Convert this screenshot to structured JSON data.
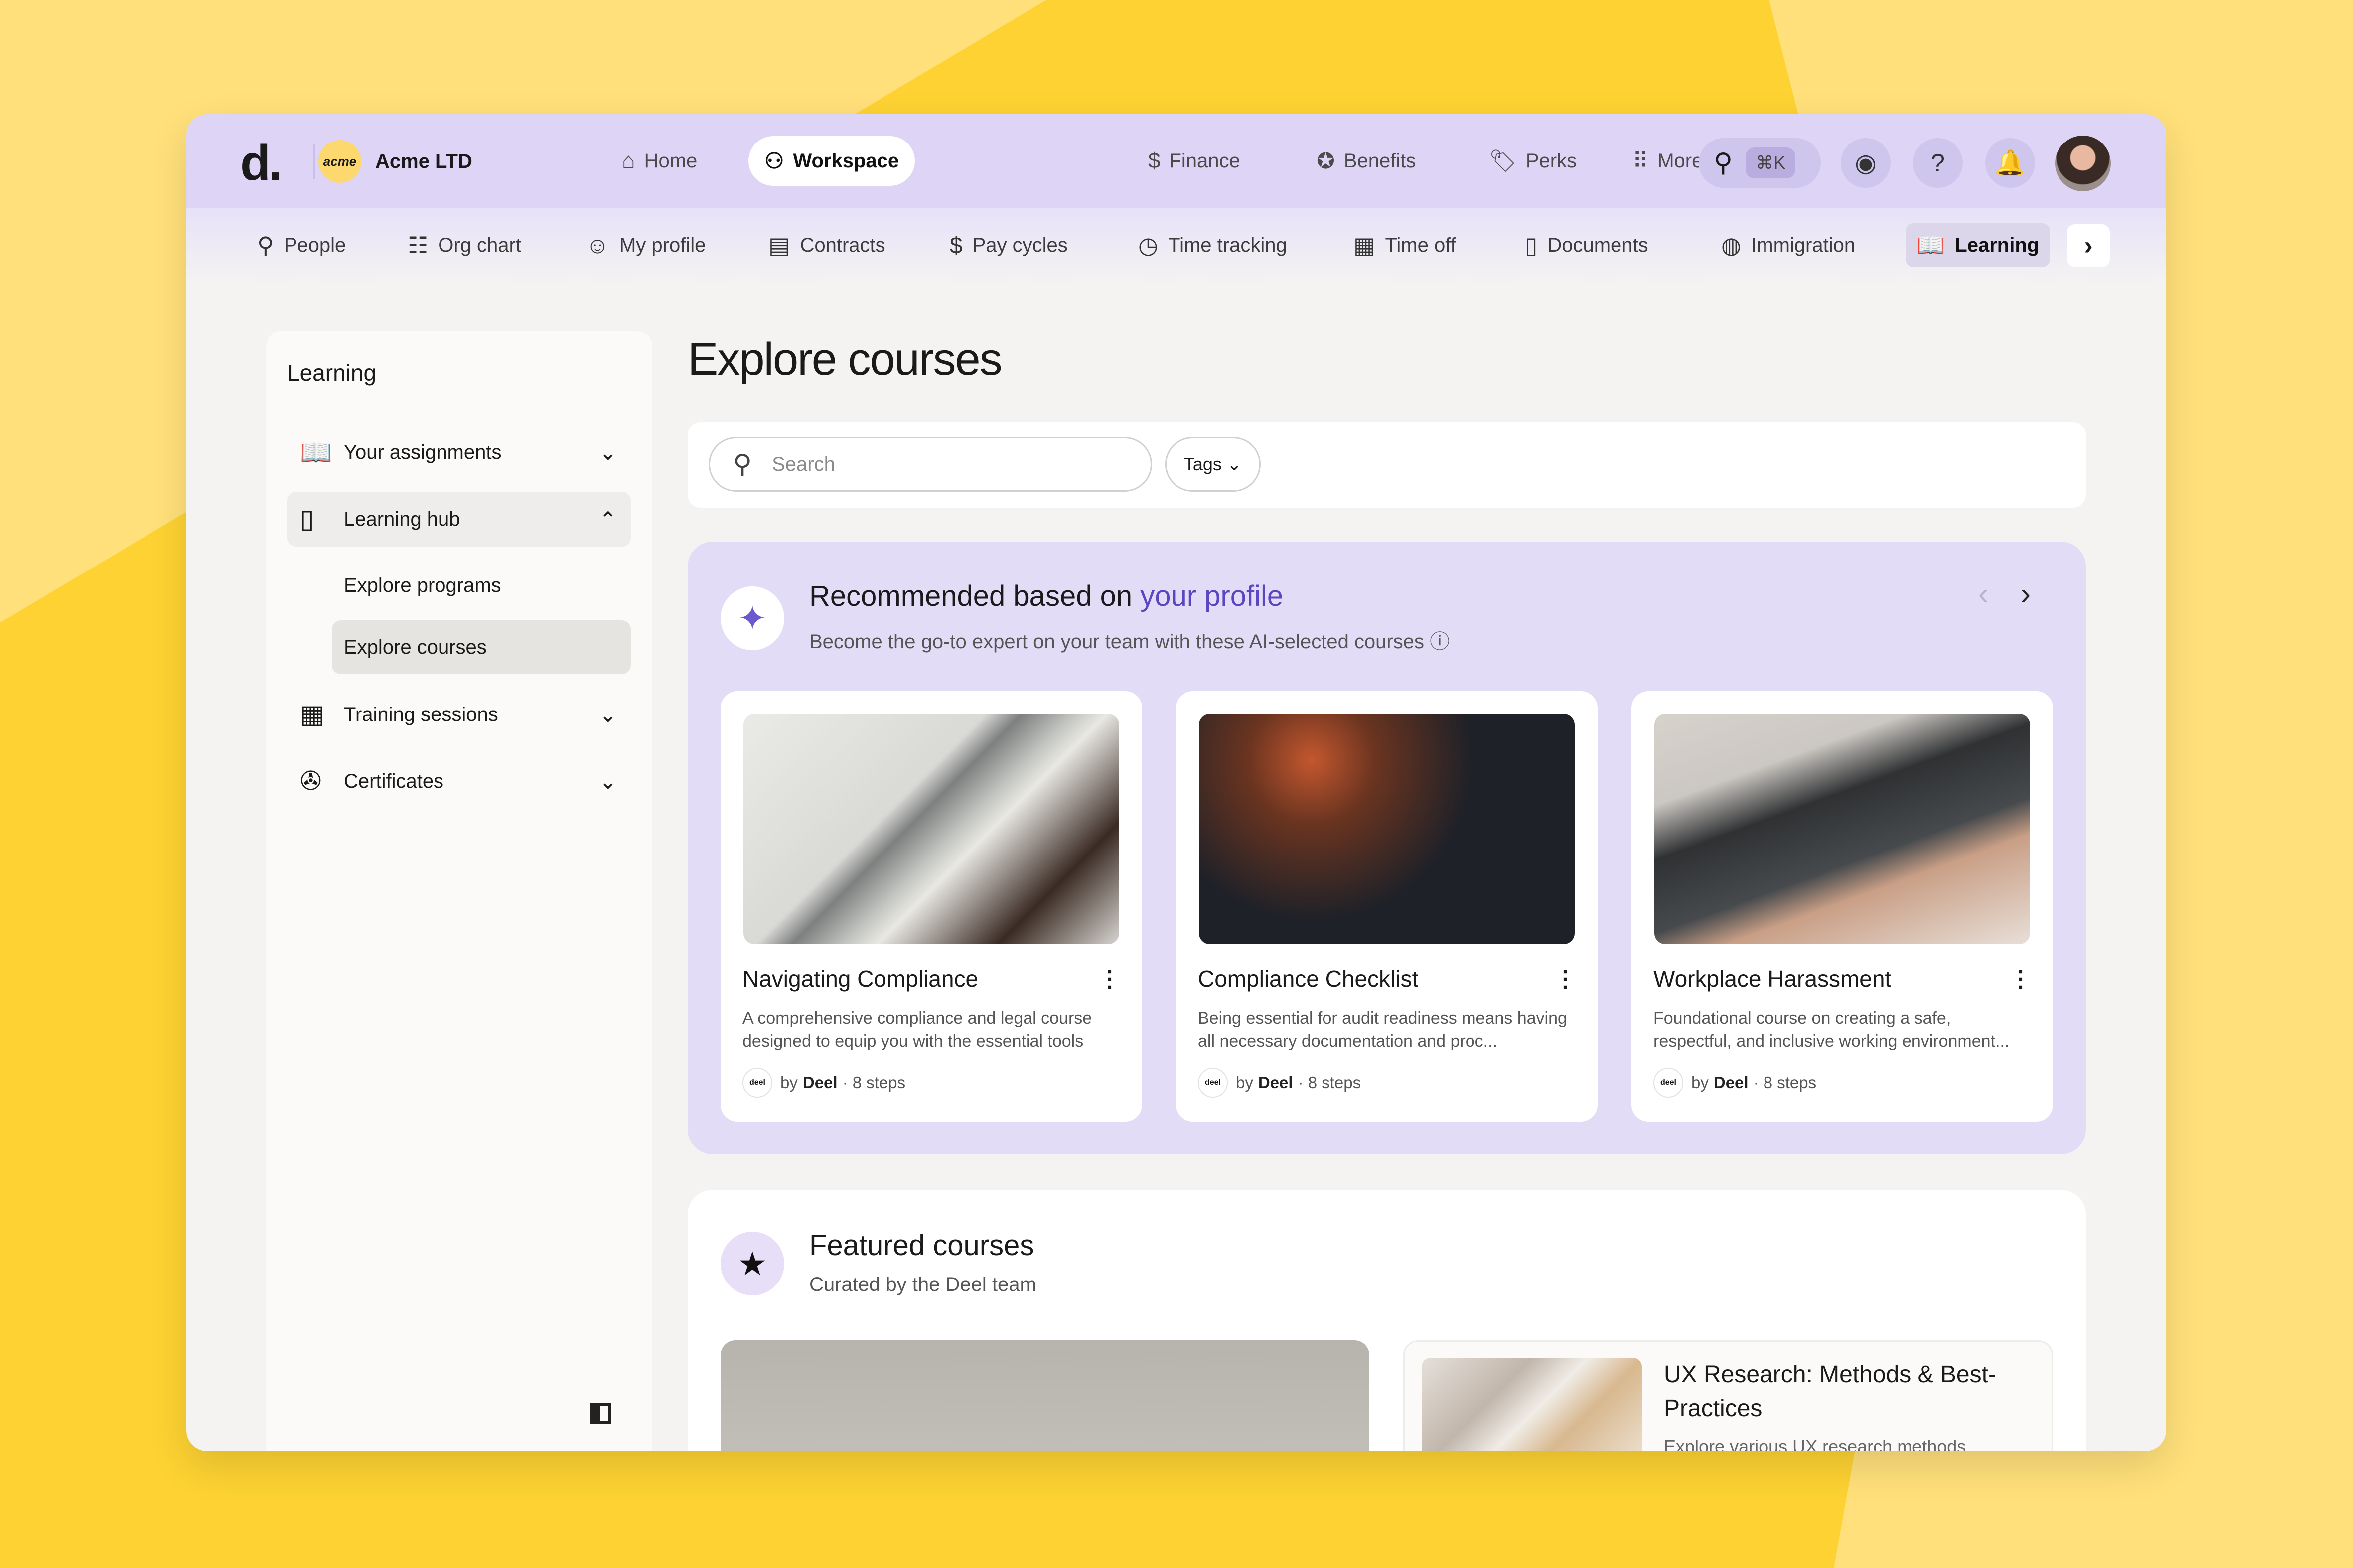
{
  "brand": {
    "logo": "d.",
    "org_badge": "acme",
    "org_name": "Acme LTD"
  },
  "top_nav": [
    {
      "label": "Home",
      "icon": "home-icon",
      "glyph": "⌂"
    },
    {
      "label": "Workspace",
      "icon": "workspace-icon",
      "glyph": "⚇"
    },
    {
      "label": "Finance",
      "icon": "dollar-icon",
      "glyph": "$"
    },
    {
      "label": "Benefits",
      "icon": "star-badge-icon",
      "glyph": "✪"
    },
    {
      "label": "Perks",
      "icon": "tag-icon",
      "glyph": "🏷"
    },
    {
      "label": "More",
      "icon": "grid-icon",
      "glyph": "⠿"
    }
  ],
  "top_actions": {
    "search_shortcut": "⌘K"
  },
  "sub_nav": [
    {
      "label": "People",
      "glyph": "⚲"
    },
    {
      "label": "Org chart",
      "glyph": "☷"
    },
    {
      "label": "My profile",
      "glyph": "☺"
    },
    {
      "label": "Contracts",
      "glyph": "▤"
    },
    {
      "label": "Pay cycles",
      "glyph": "$"
    },
    {
      "label": "Time tracking",
      "glyph": "◷"
    },
    {
      "label": "Time off",
      "glyph": "▦"
    },
    {
      "label": "Documents",
      "glyph": "▯"
    },
    {
      "label": "Immigration",
      "glyph": "◍"
    },
    {
      "label": "Learning",
      "glyph": "📖"
    }
  ],
  "sidebar": {
    "title": "Learning",
    "items": [
      {
        "label": "Your assignments",
        "glyph": "📖",
        "chevron": "⌄"
      },
      {
        "label": "Learning hub",
        "glyph": "▯",
        "chevron": "⌃"
      },
      {
        "label": "Training sessions",
        "glyph": "▦",
        "chevron": "⌄"
      },
      {
        "label": "Certificates",
        "glyph": "✇",
        "chevron": "⌄"
      }
    ],
    "sub_items": [
      "Explore programs",
      "Explore courses"
    ]
  },
  "main": {
    "title": "Explore courses",
    "search_placeholder": "Search",
    "tags_label": "Tags ⌄"
  },
  "recommended": {
    "title_prefix": "Recommended based on ",
    "title_accent": "your profile",
    "subtitle": "Become the go-to expert on your team with these AI-selected courses ⓘ",
    "cards": [
      {
        "title": "Navigating Compliance",
        "desc": "A comprehensive compliance and legal course designed to equip you with the essential tools",
        "by": "by",
        "org": "Deel",
        "steps": "· 8 steps"
      },
      {
        "title": "Compliance Checklist",
        "desc": "Being essential for audit readiness means having all necessary documentation and proc...",
        "by": "by",
        "org": "Deel",
        "steps": "· 8 steps"
      },
      {
        "title": "Workplace Harassment",
        "desc": "Foundational course on creating a safe, respectful, and inclusive working environment...",
        "by": "by",
        "org": "Deel",
        "steps": "· 8 steps"
      }
    ]
  },
  "featured": {
    "title": "Featured courses",
    "subtitle": "Curated by the Deel team",
    "card_title": "UX Research: Methods & Best-Practices",
    "card_desc": "Explore various UX research methods"
  },
  "colors": {
    "accent": "#5b46c2",
    "topbar": "#ddd4f6",
    "background": "#fdd232"
  }
}
